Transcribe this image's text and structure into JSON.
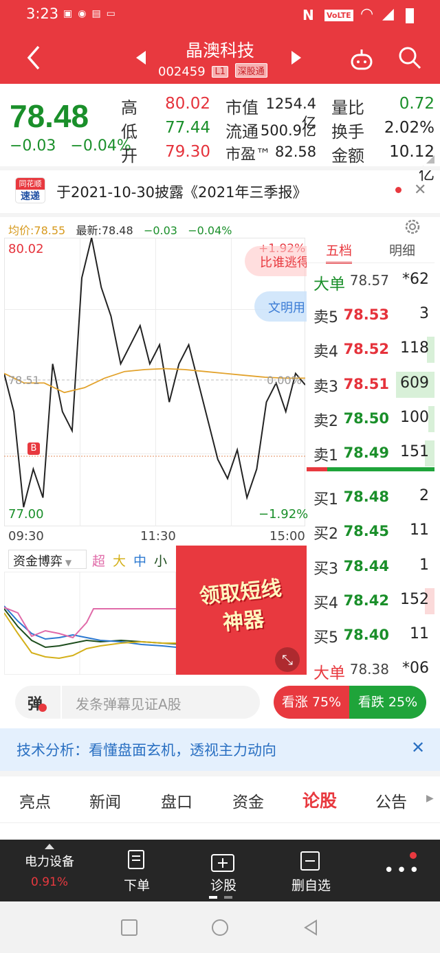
{
  "status": {
    "time": "3:23",
    "volte": "VoLTE"
  },
  "header": {
    "stock_name": "晶澳科技",
    "stock_code": "002459",
    "level_tag": "L1",
    "market_tag": "深股通"
  },
  "quote": {
    "price": "78.48",
    "change": "−0.03",
    "change_pct": "−0.04%",
    "high_label": "高",
    "high": "80.02",
    "low_label": "低",
    "low": "77.44",
    "open_label": "开",
    "open": "79.30",
    "mcap_label": "市值",
    "mcap": "1254.4亿",
    "float_label": "流通",
    "float": "500.9亿",
    "pe_label": "市盈™",
    "pe": "82.58",
    "vol_ratio_label": "量比",
    "vol_ratio": "0.72",
    "turnover_label": "换手",
    "turnover": "2.02%",
    "amount_label": "金额",
    "amount": "10.12亿"
  },
  "notice": {
    "logo_top": "同花顺",
    "logo_bottom": "速递",
    "text": "于2021-10-30披露《2021年三季报》"
  },
  "chart": {
    "avg_label": "均价:78.55",
    "latest_label": "最新:78.48",
    "chg": "−0.03",
    "chg_pct": "−0.04%",
    "y_high": "80.02",
    "y_mid": "78.51",
    "y_low": "77.00",
    "pct_high": "+1.92%",
    "pct_mid": "0.00%",
    "pct_low": "−1.92%",
    "t_start": "09:30",
    "t_mid": "11:30",
    "t_end": "15:00",
    "marker": "B",
    "bubble1": "比谁逃得",
    "bubble2": "文明用"
  },
  "chart_data": {
    "type": "line",
    "x": [
      "09:30",
      "11:30",
      "15:00"
    ],
    "ylim": [
      77.0,
      80.02
    ],
    "series": [
      {
        "values": [
          78.6,
          78.2,
          77.2,
          77.6,
          77.3,
          78.7,
          78.2,
          78.0,
          79.6,
          80.02,
          79.5,
          79.2,
          78.7,
          78.9,
          79.1,
          78.7,
          78.9,
          78.3,
          78.7,
          78.9,
          78.5,
          78.1,
          77.7,
          77.5,
          77.8,
          77.3,
          77.6,
          78.3,
          78.5,
          78.2,
          78.6,
          78.48
        ]
      },
      {
        "values": [
          78.6,
          78.5,
          78.5,
          78.4,
          78.45,
          78.55,
          78.62,
          78.64,
          78.65,
          78.64,
          78.62,
          78.6,
          78.58,
          78.56,
          78.55,
          78.55
        ]
      }
    ]
  },
  "fund": {
    "selector": "资金博弈",
    "super": "超",
    "large": "大",
    "medium": "中",
    "small": "小",
    "ad": "领取短线神器"
  },
  "orderbook": {
    "tab1": "五档",
    "tab2": "明细",
    "big_sell": {
      "label": "大单",
      "price": "78.57",
      "vol": "*62"
    },
    "asks": [
      {
        "label": "卖5",
        "price": "78.53",
        "vol": "3"
      },
      {
        "label": "卖4",
        "price": "78.52",
        "vol": "118"
      },
      {
        "label": "卖3",
        "price": "78.51",
        "vol": "609"
      },
      {
        "label": "卖2",
        "price": "78.50",
        "vol": "100"
      },
      {
        "label": "卖1",
        "price": "78.49",
        "vol": "151"
      }
    ],
    "bids": [
      {
        "label": "买1",
        "price": "78.48",
        "vol": "2"
      },
      {
        "label": "买2",
        "price": "78.45",
        "vol": "11"
      },
      {
        "label": "买3",
        "price": "78.44",
        "vol": "1"
      },
      {
        "label": "买4",
        "price": "78.42",
        "vol": "152"
      },
      {
        "label": "买5",
        "price": "78.40",
        "vol": "11"
      }
    ],
    "big_buy": {
      "label": "大单",
      "price": "78.38",
      "vol": "*06"
    }
  },
  "danmu": {
    "icon": "弹",
    "placeholder": "发条弹幕见证A股",
    "bull": "看涨 75%",
    "bear": "看跌 25%"
  },
  "banner": {
    "text": "技术分析：看懂盘面玄机，透视主力动向"
  },
  "tabs": [
    "亮点",
    "新闻",
    "盘口",
    "资金",
    "论股",
    "公告"
  ],
  "bottom": {
    "sector": "电力设备",
    "sector_pct": "0.91%",
    "order": "下单",
    "diagnose": "诊股",
    "remove": "删自选"
  },
  "colors": {
    "brand_red": "#e8393f",
    "down_green": "#1a8f2a",
    "avg_line": "#e2a22c"
  }
}
